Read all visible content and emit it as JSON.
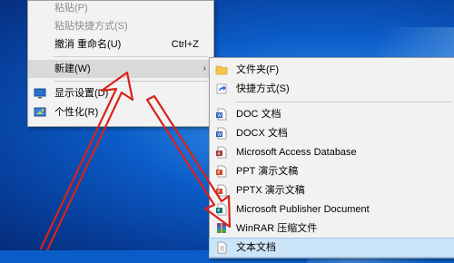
{
  "context_menu": {
    "items": [
      {
        "label": "粘贴(P)",
        "disabled": true
      },
      {
        "label": "粘贴快捷方式(S)",
        "disabled": true
      },
      {
        "label": "撤消 重命名(U)",
        "accel": "Ctrl+Z"
      },
      {
        "label": "新建(W)",
        "submenu_arrow": "›"
      },
      {
        "label": "显示设置(D)",
        "icon": "display-icon"
      },
      {
        "label": "个性化(R)",
        "icon": "personalize-icon"
      }
    ]
  },
  "new_submenu": {
    "items": [
      {
        "label": "文件夹(F)",
        "icon": "folder-icon"
      },
      {
        "label": "快捷方式(S)",
        "icon": "shortcut-icon"
      },
      {
        "label": "DOC 文档",
        "icon": "doc-icon"
      },
      {
        "label": "DOCX 文档",
        "icon": "docx-icon"
      },
      {
        "label": "Microsoft Access Database",
        "icon": "access-icon"
      },
      {
        "label": "PPT 演示文稿",
        "icon": "ppt-icon"
      },
      {
        "label": "PPTX 演示文稿",
        "icon": "pptx-icon"
      },
      {
        "label": "Microsoft Publisher Document",
        "icon": "publisher-icon"
      },
      {
        "label": "WinRAR 压缩文件",
        "icon": "winrar-icon"
      },
      {
        "label": "文本文档",
        "icon": "text-document-icon"
      }
    ]
  },
  "colors": {
    "menu_bg": "#f2f2f2",
    "highlight": "#d9d9d9",
    "annotation_arrow": "#d9221a"
  }
}
